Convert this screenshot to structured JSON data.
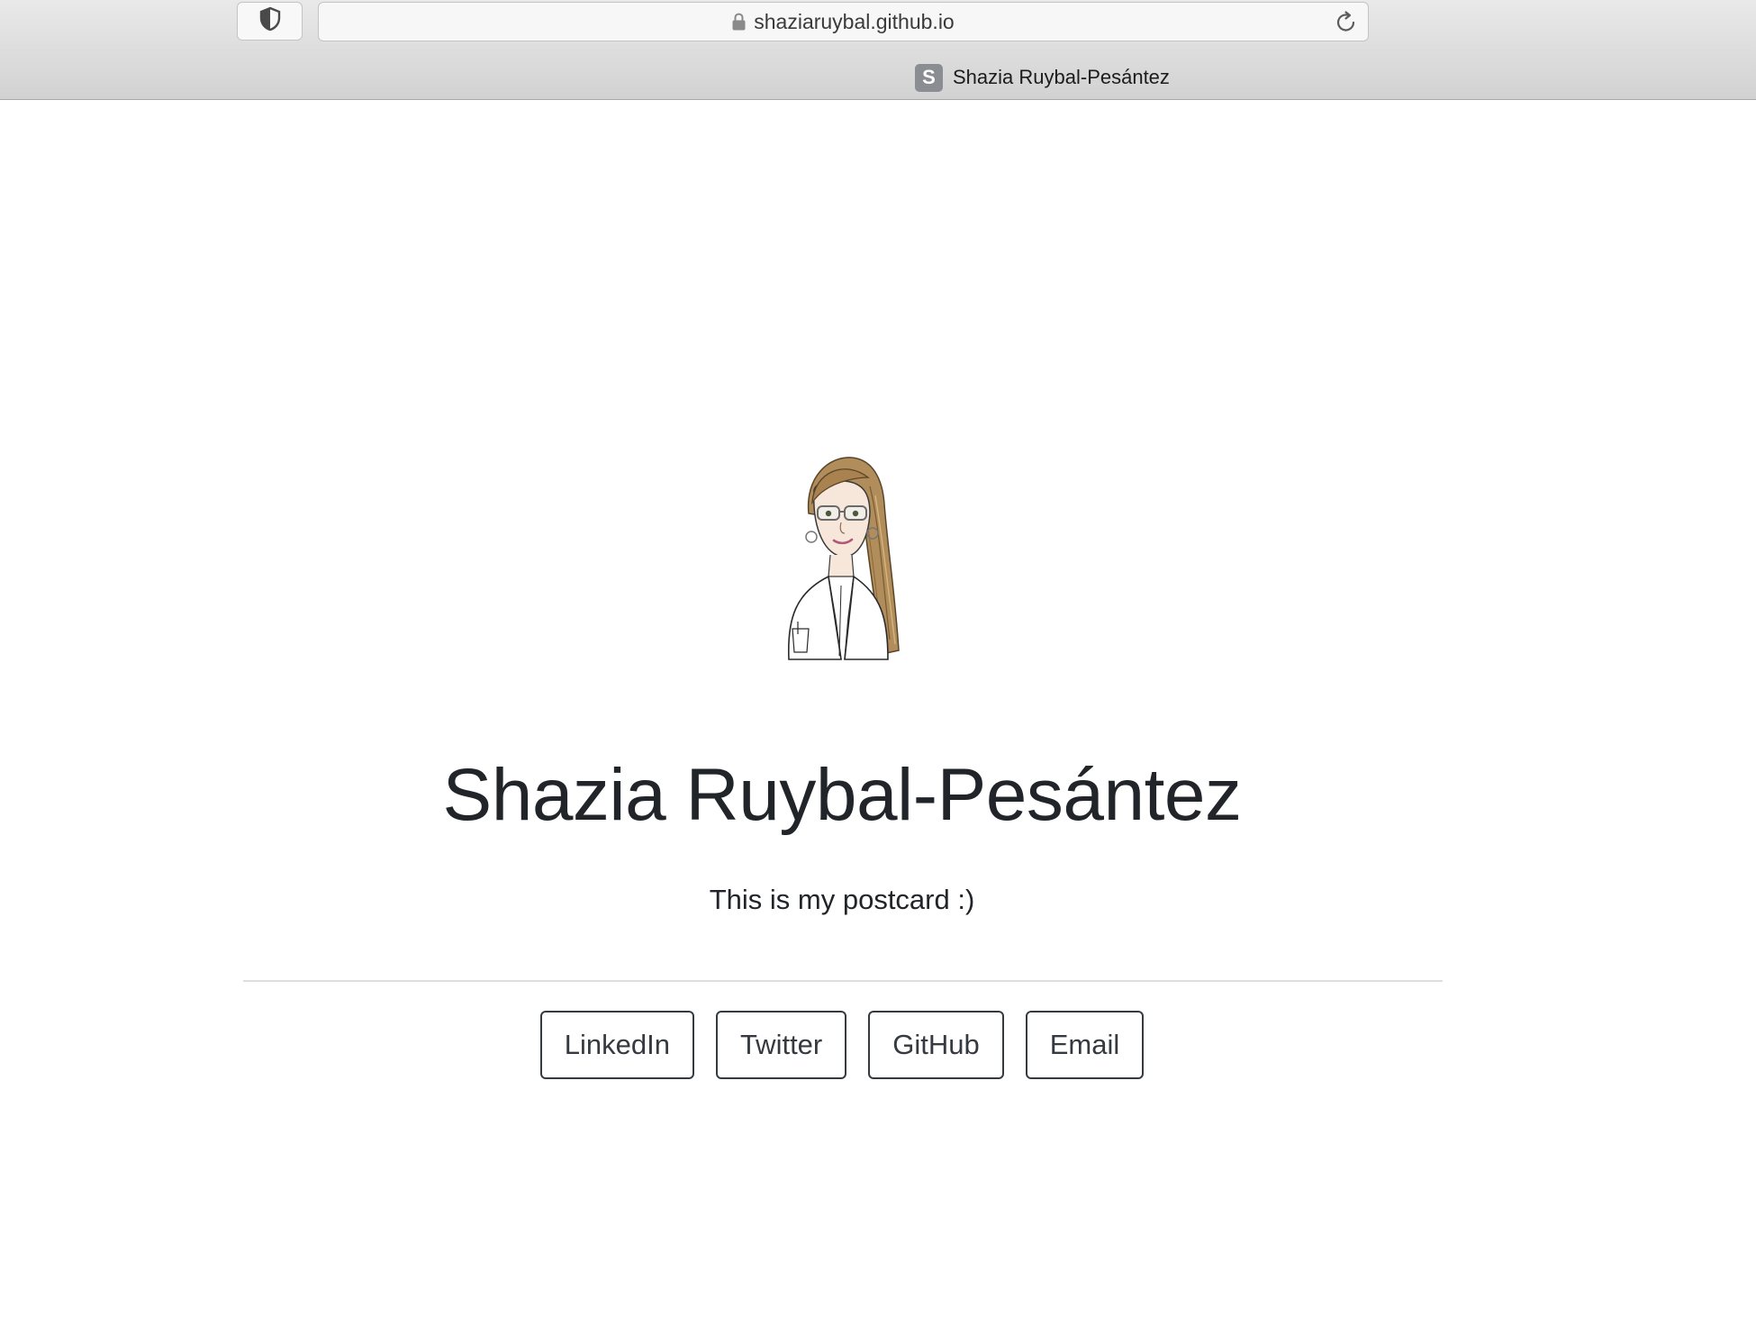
{
  "browser": {
    "url": "shaziaruybal.github.io",
    "tab_title": "Shazia Ruybal-Pesántez",
    "favicon_letter": "S",
    "icons": {
      "shield": "privacy-shield-icon",
      "lock": "lock-icon",
      "reload": "reload-icon"
    }
  },
  "page": {
    "title": "Shazia Ruybal-Pesántez",
    "subtitle": "This is my postcard :)",
    "avatar": "cartoon-portrait-avatar",
    "links": [
      {
        "label": "LinkedIn"
      },
      {
        "label": "Twitter"
      },
      {
        "label": "GitHub"
      },
      {
        "label": "Email"
      }
    ]
  },
  "colors": {
    "text": "#212529",
    "button_border": "#343a40",
    "chrome_bg": "#d9d9d9"
  }
}
